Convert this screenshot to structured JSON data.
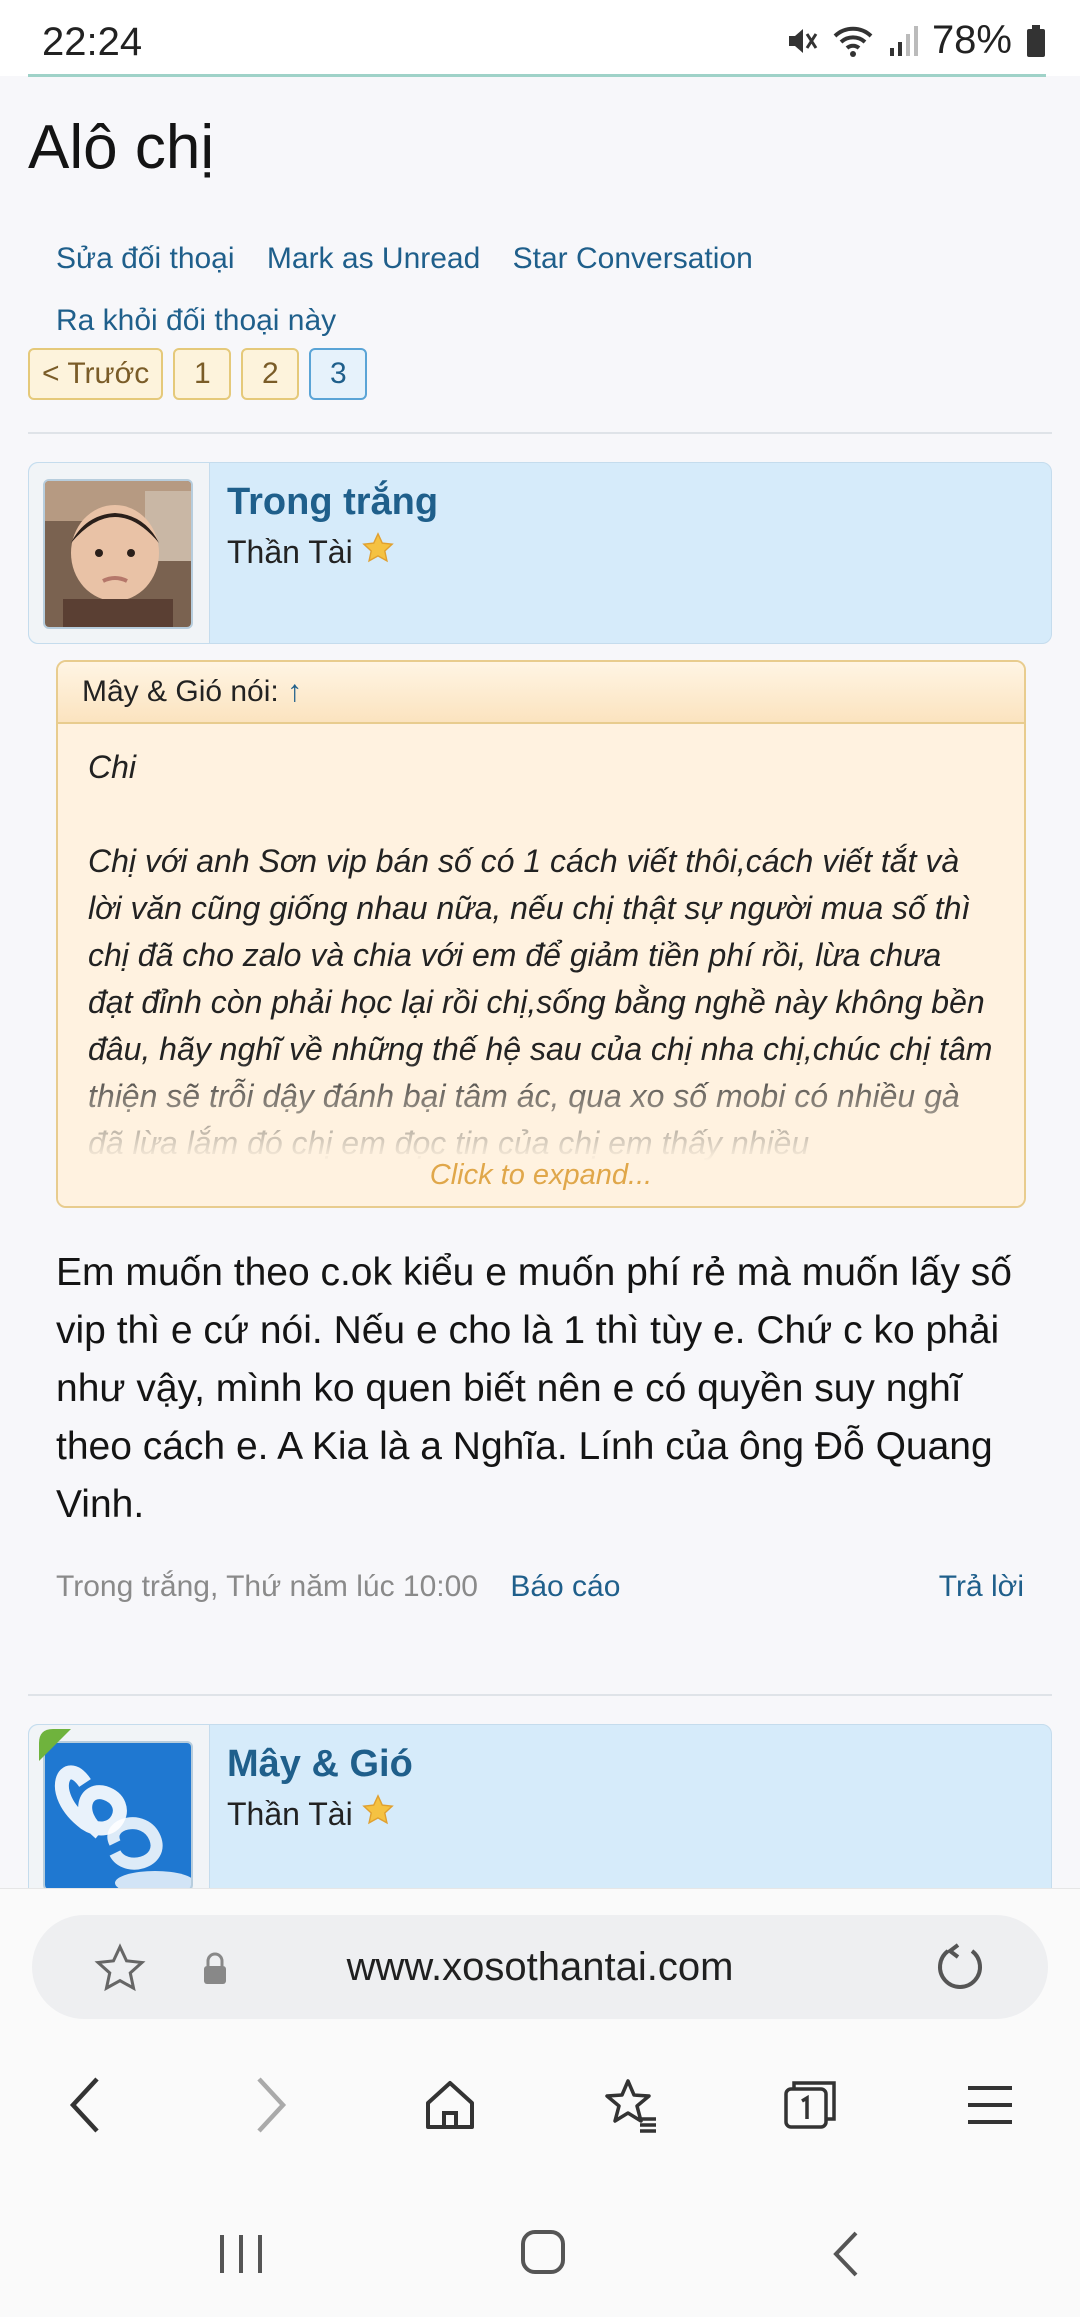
{
  "status": {
    "time": "22:24",
    "battery": "78%"
  },
  "page": {
    "title": "Alô chị",
    "links": [
      "Sửa đối thoại",
      "Mark as Unread",
      "Star Conversation",
      "Ra khỏi đối thoại này"
    ],
    "pager": {
      "prev": "< Trước",
      "pages": [
        "1",
        "2",
        "3"
      ],
      "current": "3"
    }
  },
  "message1": {
    "username": "Trong trắng",
    "usertitle": "Thần Tài",
    "quote": {
      "header": "Mây & Gió nói:",
      "arrow": "↑",
      "line1": "Chi",
      "text": "Chị với anh Sơn vip bán số có 1 cách viết thôi,cách viết tắt và lời văn cũng giống nhau nữa, nếu chị thật sự người mua số thì chị đã cho zalo và chia với em để giảm tiền phí rồi, lừa chưa đạt đỉnh còn phải học lại rồi chị,sống bằng nghề này không bền đâu, hãy nghĩ về những thế hệ sau của chị nha chị,chúc chị tâm thiện sẽ trỗi dậy đánh bại tâm ác, qua xo số mobi có nhiều gà đã lừa lắm đó chị em đọc tin của chị em thấy nhiều",
      "expand": "Click to expand..."
    },
    "body": "Em muốn theo c.ok kiểu e muốn phí rẻ mà muốn lấy số vip thì e cứ nói. Nếu e cho là 1 thì tùy e. Chứ c ko phải như vậy, mình ko quen biết nên e có quyền suy nghĩ theo cách e. A Kia là a Nghĩa. Lính của ông Đỗ Quang Vinh.",
    "meta": "Trong trắng, Thứ năm lúc 10:00",
    "report": "Báo cáo",
    "reply": "Trả lời"
  },
  "message2": {
    "username": "Mây & Gió",
    "usertitle": "Thần Tài"
  },
  "browser": {
    "url": "www.xosothantai.com"
  },
  "icons": [
    "mute-icon",
    "wifi-icon",
    "signal-icon",
    "battery-icon",
    "star-icon",
    "lock-icon",
    "reload-icon",
    "back-icon",
    "forward-icon",
    "home-icon",
    "bookmarks-icon",
    "tabs-icon",
    "menu-icon"
  ]
}
